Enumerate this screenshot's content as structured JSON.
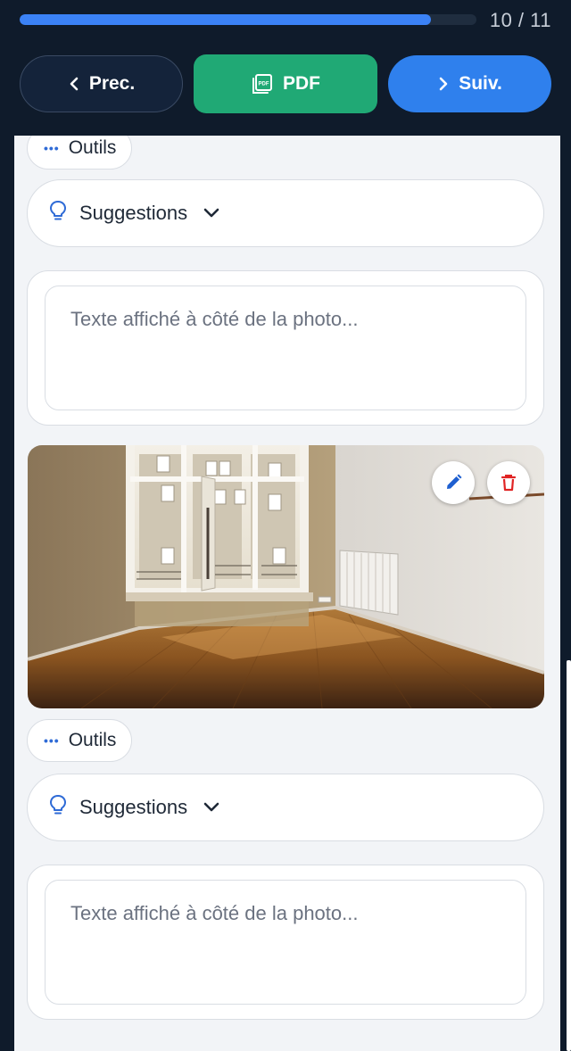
{
  "progress": {
    "text": "10 / 11",
    "fraction": 0.9
  },
  "nav": {
    "prev_label": "Prec.",
    "pdf_label": "PDF",
    "next_label": "Suiv."
  },
  "icons": {
    "prev": "chevron-left-icon",
    "pdf": "pdf-file-icon",
    "next": "chevron-right-icon",
    "tools": "dots-icon",
    "suggestions": "lightbulb-icon",
    "dropdown": "chevron-down-icon",
    "edit": "pencil-icon",
    "delete": "trash-icon"
  },
  "colors": {
    "background": "#0f1b2b",
    "progress": "#3b82f6",
    "pdf_button": "#20a975",
    "next_button": "#2f80ed",
    "accent": "#2f6bd6",
    "delete": "#e02424"
  },
  "blocks": [
    {
      "tools_label": "Outils",
      "suggestions_label": "Suggestions",
      "text_placeholder": "Texte affiché à côté de la photo..."
    },
    {
      "tools_label": "Outils",
      "suggestions_label": "Suggestions",
      "text_placeholder": "Texte affiché à côté de la photo..."
    }
  ]
}
